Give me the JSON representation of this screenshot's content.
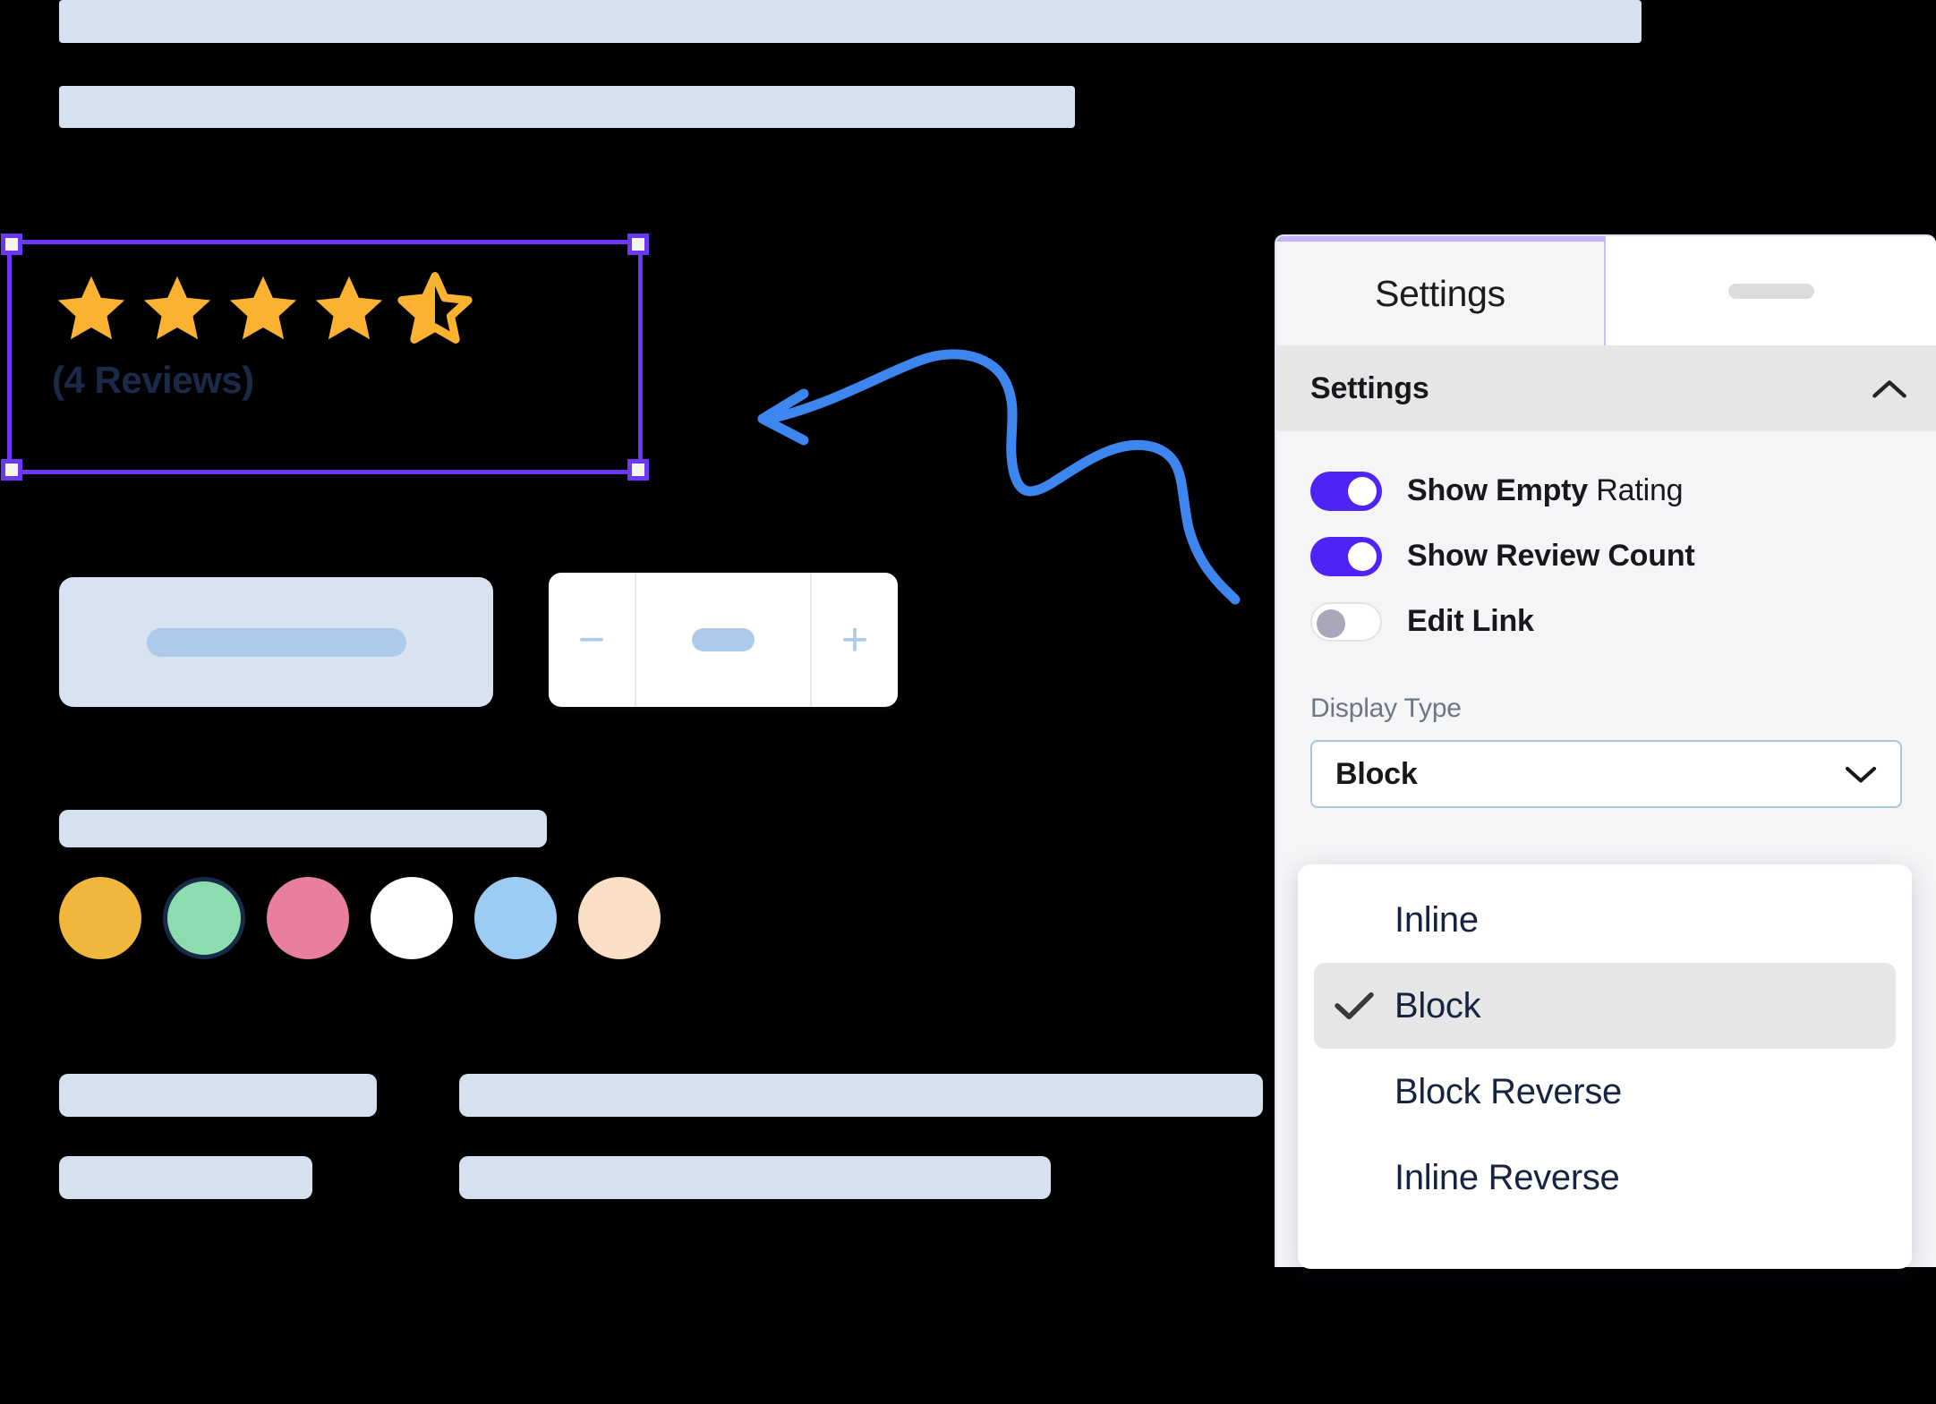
{
  "preview": {
    "top_bars": [
      {
        "label": "title-placeholder-bar"
      },
      {
        "label": "subtitle-placeholder-bar"
      }
    ],
    "rating": {
      "stars_total": 5,
      "stars_filled": 4,
      "partial_fraction": 0.5,
      "review_count_label": "(4 Reviews)",
      "star_color": "#fbb231",
      "star_empty_color": "#ffffff",
      "selected": true,
      "selection_color": "#6d38f5"
    },
    "add_to_cart_button": {
      "label": "add-to-cart-skeleton"
    },
    "quantity_stepper": {
      "decrement_label": "−",
      "increment_label": "+",
      "value_placeholder": "quantity-value-skeleton"
    },
    "swatches_label_bar": "variant-label-placeholder",
    "swatches": [
      {
        "name": "amber",
        "color": "#f0b73c",
        "selected": false
      },
      {
        "name": "mint",
        "color": "#8ddcb0",
        "selected": true
      },
      {
        "name": "pink",
        "color": "#e87f9d",
        "selected": false
      },
      {
        "name": "white",
        "color": "#ffffff",
        "selected": false
      },
      {
        "name": "blue",
        "color": "#9ccbf4",
        "selected": false
      },
      {
        "name": "peach",
        "color": "#fadfc5",
        "selected": false
      }
    ],
    "bottom_bars": [
      {
        "label": "detail-label-1"
      },
      {
        "label": "detail-value-1"
      },
      {
        "label": "detail-label-2"
      },
      {
        "label": "detail-value-2"
      }
    ],
    "annotation": {
      "type": "curved-arrow",
      "color": "#3d86ef",
      "direction": "points-left"
    }
  },
  "panel": {
    "tabs": [
      {
        "label": "Settings",
        "active": true
      },
      {
        "label": "",
        "active": false,
        "placeholder": true
      }
    ],
    "section": {
      "title": "Settings",
      "collapse_icon": "chevron-up-icon",
      "expanded": true
    },
    "toggles": [
      {
        "label_strong": "Show Empty",
        "label_light": " Rating",
        "on": true
      },
      {
        "label_strong": "Show Review Count",
        "label_light": "",
        "on": true
      },
      {
        "label_strong": "Edit Link",
        "label_light": "",
        "on": false
      }
    ],
    "display_type": {
      "label": "Display Type",
      "value": "Block",
      "chevron_icon": "chevron-down-icon",
      "options": [
        {
          "label": "Inline",
          "selected": false
        },
        {
          "label": "Block",
          "selected": true
        },
        {
          "label": "Block Reverse",
          "selected": false
        },
        {
          "label": "Inline Reverse",
          "selected": false
        }
      ]
    },
    "colors": {
      "toggle_on": "#4f22f5",
      "tab_accent": "#c3b5f7",
      "section_header_bg": "#e6e6e6"
    }
  }
}
